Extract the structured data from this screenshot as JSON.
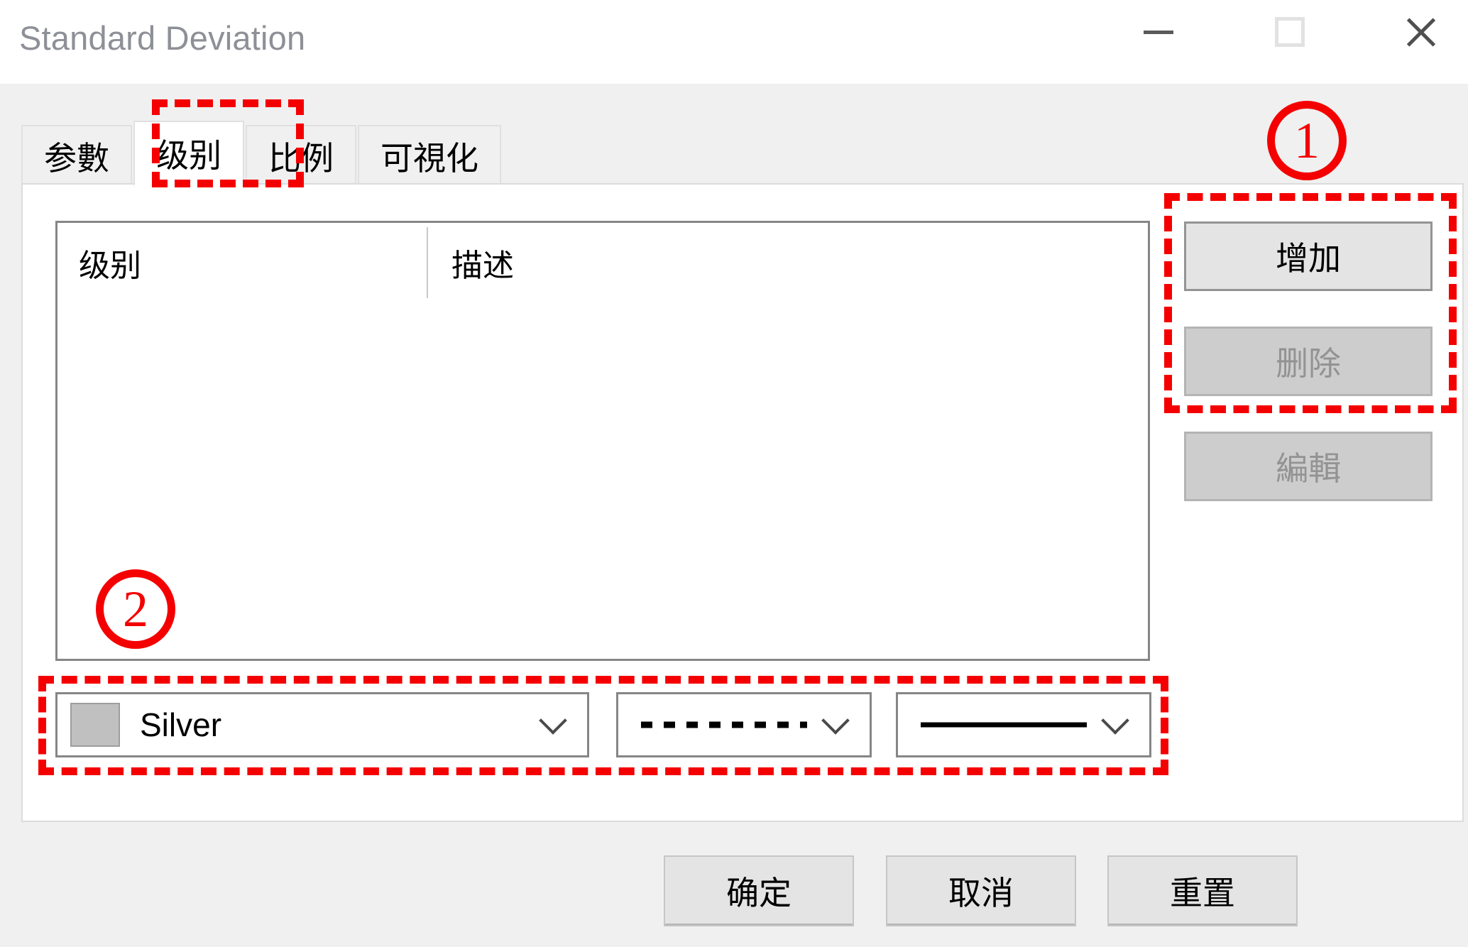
{
  "window": {
    "title": "Standard Deviation",
    "controls": {
      "minimize": "minimize-icon",
      "maximize": "maximize-icon",
      "close": "close-icon"
    }
  },
  "tabs": [
    {
      "label": "参數",
      "active": false
    },
    {
      "label": "级别",
      "active": true
    },
    {
      "label": "比例",
      "active": false
    },
    {
      "label": "可視化",
      "active": false
    }
  ],
  "list": {
    "columns": [
      "级别",
      "描述"
    ],
    "rows": []
  },
  "side_buttons": [
    {
      "label": "增加",
      "enabled": true
    },
    {
      "label": "删除",
      "enabled": false
    },
    {
      "label": "編輯",
      "enabled": false
    }
  ],
  "style_row": {
    "color": {
      "value": "Silver",
      "swatch_hex": "#c0c0c0"
    },
    "line_style": {
      "value": "dashed",
      "preview": "- - - - - - - - - -"
    },
    "line_width": {
      "value": "solid",
      "preview": "solid-line"
    }
  },
  "footer_buttons": [
    {
      "label": "确定"
    },
    {
      "label": "取消"
    },
    {
      "label": "重置"
    }
  ],
  "annotations": {
    "accent_hex": "#f50000",
    "markers": [
      {
        "number": "1",
        "target": "side-buttons-group"
      },
      {
        "number": "2",
        "target": "style-row-group"
      }
    ],
    "highlight_boxes": [
      "active-tab",
      "side-buttons-group",
      "style-row-group"
    ]
  }
}
